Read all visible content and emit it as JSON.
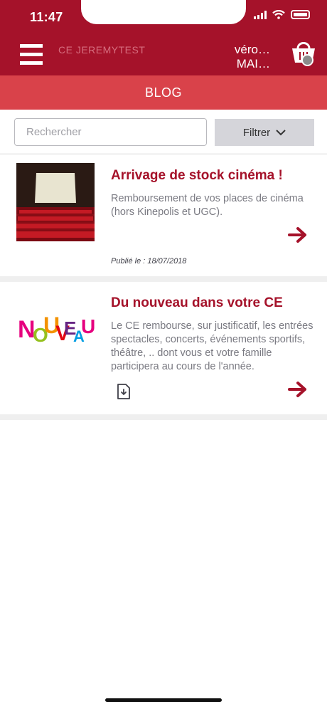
{
  "status_bar": {
    "time": "11:47"
  },
  "header": {
    "app_name": "CE JEREMYTEST",
    "user_first": "véro…",
    "user_last": "MAI…",
    "menu_icon": "hamburger-icon",
    "cart_icon": "shopping-basket-icon"
  },
  "section_title": "BLOG",
  "search": {
    "placeholder": "Rechercher"
  },
  "filter": {
    "label": "Filtrer"
  },
  "posts": [
    {
      "title": "Arrivage de stock cinéma !",
      "excerpt": "Remboursement de vos places de cinéma (hors Kinepolis et UGC).",
      "date": "Publié le : 18/07/2018",
      "image": "cinema-screen"
    },
    {
      "title": "Du nouveau dans votre CE",
      "excerpt": "Le CE rembourse, sur justificatif, les entrées spectacles, concerts, événements sportifs, théâtre, .. dont vous et votre famille participera au cours de l'année.",
      "logo_text": "NOUVEAU",
      "attachment_icon": "document-download-icon"
    }
  ],
  "colors": {
    "primary": "#a5122a",
    "secondary": "#d9424a",
    "text_muted": "#7a7a82"
  }
}
